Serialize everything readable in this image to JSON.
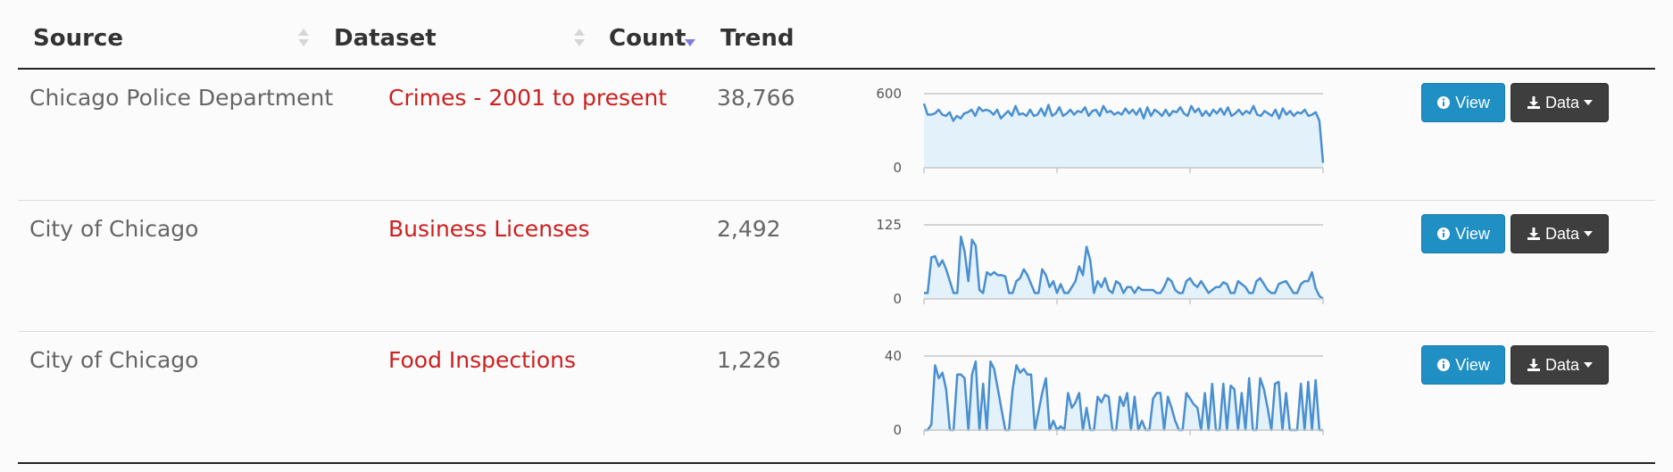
{
  "header": {
    "source": "Source",
    "dataset": "Dataset",
    "count": "Count",
    "trend": "Trend"
  },
  "colors": {
    "link": "#cc1f1f",
    "view_button": "#1f8fc4",
    "data_button": "#3e3e3e",
    "trend_line": "#4a8fcf",
    "trend_fill": "#e3f2fa",
    "active_sort": "#7d7ddc"
  },
  "rows": [
    {
      "source": "Chicago Police Department",
      "dataset": "Crimes - 2001 to present",
      "count": "38,766",
      "view_label": "View",
      "data_label": "Data"
    },
    {
      "source": "City of Chicago",
      "dataset": "Business Licenses",
      "count": "2,492",
      "view_label": "View",
      "data_label": "Data"
    },
    {
      "source": "City of Chicago",
      "dataset": "Food Inspections",
      "count": "1,226",
      "view_label": "View",
      "data_label": "Data"
    }
  ],
  "chart_data": [
    {
      "type": "area",
      "ylim": [
        0,
        600
      ],
      "ytick_labels": [
        "600",
        "0"
      ],
      "values": [
        520,
        430,
        430,
        440,
        470,
        430,
        420,
        450,
        380,
        420,
        400,
        440,
        450,
        470,
        420,
        490,
        460,
        470,
        460,
        430,
        470,
        400,
        430,
        460,
        420,
        500,
        430,
        440,
        420,
        470,
        420,
        430,
        480,
        420,
        510,
        420,
        440,
        490,
        420,
        440,
        470,
        430,
        460,
        450,
        490,
        420,
        460,
        470,
        420,
        500,
        450,
        460,
        430,
        450,
        430,
        480,
        440,
        470,
        430,
        480,
        400,
        490,
        420,
        470,
        450,
        420,
        470,
        420,
        460,
        450,
        490,
        440,
        420,
        500,
        450,
        480,
        420,
        460,
        420,
        470,
        440,
        480,
        430,
        490,
        420,
        440,
        470,
        430,
        460,
        440,
        500,
        430,
        420,
        460,
        440,
        420,
        470,
        400,
        480,
        430,
        460,
        420,
        450,
        440,
        470,
        420,
        430,
        450,
        380,
        40
      ]
    },
    {
      "type": "area",
      "ylim": [
        0,
        125
      ],
      "ytick_labels": [
        "125",
        "0"
      ],
      "values": [
        10,
        10,
        70,
        72,
        55,
        65,
        50,
        30,
        10,
        10,
        105,
        80,
        30,
        100,
        90,
        15,
        10,
        45,
        40,
        45,
        40,
        40,
        38,
        10,
        10,
        30,
        35,
        50,
        40,
        25,
        10,
        10,
        50,
        40,
        20,
        30,
        10,
        25,
        10,
        10,
        20,
        30,
        55,
        40,
        88,
        65,
        10,
        30,
        20,
        35,
        15,
        10,
        30,
        25,
        10,
        20,
        20,
        10,
        20,
        15,
        15,
        15,
        15,
        10,
        10,
        20,
        35,
        30,
        15,
        10,
        10,
        30,
        35,
        25,
        20,
        30,
        20,
        10,
        15,
        20,
        20,
        28,
        25,
        10,
        10,
        30,
        25,
        20,
        10,
        10,
        30,
        35,
        25,
        15,
        10,
        10,
        25,
        28,
        30,
        20,
        10,
        10,
        25,
        30,
        30,
        45,
        18,
        5,
        0
      ]
    },
    {
      "type": "area",
      "ylim": [
        0,
        40
      ],
      "ytick_labels": [
        "40",
        "0"
      ],
      "values": [
        0,
        0,
        3,
        35,
        28,
        31,
        22,
        0,
        0,
        30,
        30,
        28,
        0,
        30,
        37,
        0,
        25,
        0,
        37,
        33,
        22,
        11,
        0,
        0,
        22,
        35,
        31,
        33,
        30,
        30,
        0,
        10,
        20,
        28,
        0,
        5,
        0,
        2,
        0,
        20,
        12,
        15,
        20,
        0,
        12,
        0,
        0,
        18,
        15,
        19,
        18,
        0,
        0,
        18,
        13,
        20,
        0,
        18,
        0,
        5,
        0,
        0,
        17,
        20,
        20,
        0,
        18,
        12,
        5,
        0,
        0,
        20,
        17,
        14,
        12,
        0,
        20,
        0,
        25,
        0,
        0,
        25,
        0,
        24,
        22,
        0,
        20,
        0,
        28,
        0,
        0,
        28,
        22,
        12,
        0,
        25,
        26,
        0,
        20,
        0,
        0,
        0,
        25,
        0,
        26,
        0,
        27,
        0,
        0
      ]
    }
  ]
}
